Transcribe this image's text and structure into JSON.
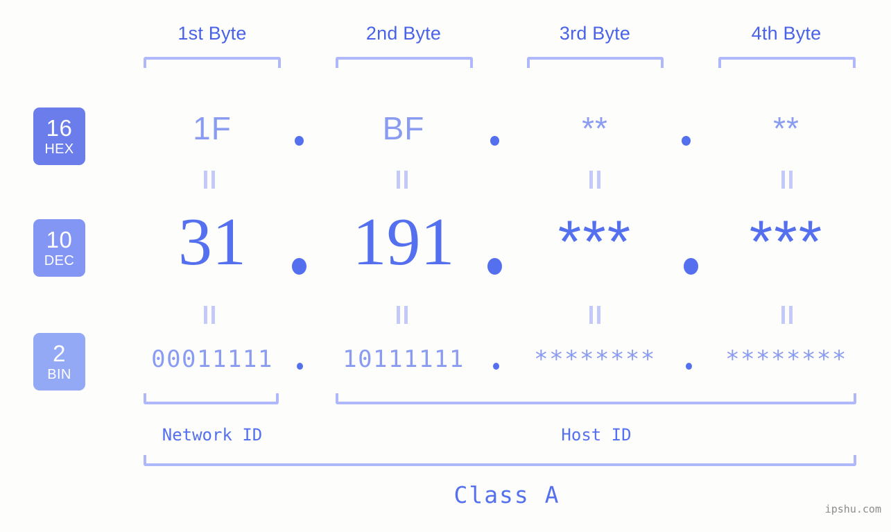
{
  "page": {
    "background": "#fdfefb",
    "watermark": "ipshu.com"
  },
  "colors": {
    "strong_blue": "#5570ee",
    "header_blue": "#4a62e8",
    "light_periwinkle": "#8a9bf2",
    "bracket": "#aeb8fb",
    "connector": "#c3caf9",
    "badge_hex": "#6b7ceb",
    "badge_dec": "#8496f3",
    "badge_bin": "#93a9f6",
    "watermark_gray": "#8b8b8b"
  },
  "headers": [
    {
      "label": "1st Byte"
    },
    {
      "label": "2nd Byte"
    },
    {
      "label": "3rd Byte"
    },
    {
      "label": "4th Byte"
    }
  ],
  "badges": [
    {
      "num": "16",
      "name": "HEX"
    },
    {
      "num": "10",
      "name": "DEC"
    },
    {
      "num": "2",
      "name": "BIN"
    }
  ],
  "rows": {
    "hex": {
      "base": "16",
      "base_name": "HEX",
      "values": [
        "1F",
        "BF",
        "**",
        "**"
      ],
      "separator": "."
    },
    "dec": {
      "base": "10",
      "base_name": "DEC",
      "values": [
        "31",
        "191",
        "***",
        "***"
      ],
      "separator": "."
    },
    "bin": {
      "base": "2",
      "base_name": "BIN",
      "values": [
        "00011111",
        "10111111",
        "********",
        "********"
      ],
      "separator": "."
    }
  },
  "segments": {
    "network_id": "Network ID",
    "host_id": "Host ID",
    "class": "Class A"
  },
  "connectors": {
    "symbol": "="
  }
}
